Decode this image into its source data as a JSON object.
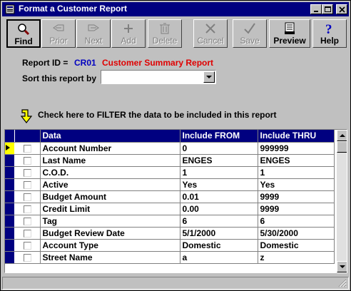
{
  "window": {
    "title": "Format a Customer Report"
  },
  "toolbar": {
    "find": "Find",
    "prior": "Prior",
    "next": "Next",
    "add": "Add",
    "delete": "Delete",
    "cancel": "Cancel",
    "save": "Save",
    "preview": "Preview",
    "help": "Help"
  },
  "report": {
    "id_label": "Report ID =",
    "id": "CR01",
    "name": "Customer Summary Report",
    "sort_label": "Sort this report by",
    "sort_value": ""
  },
  "filter_hint": "Check here to FILTER the data to be included in this report",
  "grid": {
    "headers": {
      "data": "Data",
      "from": "Include FROM",
      "thru": "Include THRU"
    },
    "rows": [
      {
        "data": "Account Number",
        "from": "0",
        "thru": "999999"
      },
      {
        "data": "Last Name",
        "from": "ENGES",
        "thru": "ENGES"
      },
      {
        "data": "C.O.D.",
        "from": "1",
        "thru": "1"
      },
      {
        "data": "Active",
        "from": "Yes",
        "thru": "Yes"
      },
      {
        "data": "Budget Amount",
        "from": "0.01",
        "thru": "9999"
      },
      {
        "data": "Credit Limit",
        "from": "0.00",
        "thru": "9999"
      },
      {
        "data": "Tag",
        "from": "6",
        "thru": "6"
      },
      {
        "data": "Budget Review Date",
        "from": "5/1/2000",
        "thru": "5/30/2000"
      },
      {
        "data": "Account Type",
        "from": "Domestic",
        "thru": "Domestic"
      },
      {
        "data": "Street Name",
        "from": "a",
        "thru": "z"
      }
    ]
  },
  "colors": {
    "title_bar": "#000080",
    "report_id": "#0000c0",
    "report_name": "#e00000",
    "row_pointer": "#ffff00"
  }
}
